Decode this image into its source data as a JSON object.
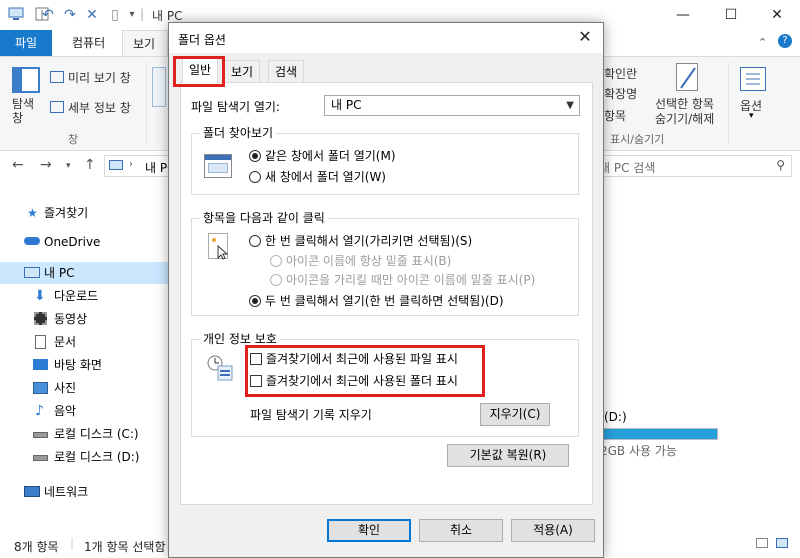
{
  "explorer": {
    "title": "내 PC",
    "tabs": {
      "file": "파일",
      "computer": "컴퓨터",
      "view": "보기"
    },
    "ribbon": {
      "navigation_pane": "탐색\n창",
      "preview_pane": "미리 보기 창",
      "details_pane": "세부 정보 창",
      "group_panes": "창",
      "item_checkboxes": "확인란",
      "file_extensions": "확장명",
      "hidden_items": "항목",
      "hide_selected": "선택한 항목",
      "hide_selected_2": "숨기기/해제",
      "group_show_hide": "표시/숨기기",
      "options": "옵션"
    },
    "address": {
      "path": "내 PC",
      "search_placeholder": "내 PC 검색"
    },
    "sidebar": [
      {
        "label": "즐겨찾기",
        "icon": "star-icon"
      },
      {
        "label": "OneDrive",
        "icon": "cloud-icon"
      },
      {
        "label": "내 PC",
        "icon": "pc-icon",
        "selected": true
      },
      {
        "label": "다운로드",
        "icon": "download-icon"
      },
      {
        "label": "동영상",
        "icon": "video-icon"
      },
      {
        "label": "문서",
        "icon": "document-icon"
      },
      {
        "label": "바탕 화면",
        "icon": "desktop-icon"
      },
      {
        "label": "사진",
        "icon": "picture-icon"
      },
      {
        "label": "음악",
        "icon": "music-icon"
      },
      {
        "label": "로컬 디스크 (C:)",
        "icon": "drive-icon"
      },
      {
        "label": "로컬 디스크 (D:)",
        "icon": "drive-icon"
      },
      {
        "label": "네트워크",
        "icon": "network-icon"
      }
    ],
    "drive": {
      "label": "(D:)",
      "free": "2GB 사용 가능",
      "fill_fraction": 1.0
    },
    "status": {
      "count": "8개 항목",
      "selected": "1개 항목 선택함"
    },
    "colors": {
      "accent": "#1979ca",
      "selection": "#cce8ff",
      "drive_bar": "#26a0da"
    }
  },
  "dialog": {
    "title": "폴더 옵션",
    "tabs": [
      "일반",
      "보기",
      "검색"
    ],
    "open_explorer_label": "파일 탐색기 열기:",
    "open_explorer_value": "내 PC",
    "browse_folders": {
      "title": "폴더 찾아보기",
      "same_window": "같은 창에서 폴더 열기(M)",
      "new_window": "새 창에서 폴더 열기(W)"
    },
    "click_items": {
      "title": "항목을 다음과 같이 클릭",
      "single_click": "한 번 클릭해서 열기(가리키면 선택됨)(S)",
      "underline_always": "아이콘 이름에 항상 밑줄 표시(B)",
      "underline_hover": "아이콘을 가리킬 때만 아이콘 이름에 밑줄 표시(P)",
      "double_click": "두 번 클릭해서 열기(한 번 클릭하면 선택됨)(D)"
    },
    "privacy": {
      "title": "개인 정보 보호",
      "recent_files": "즐겨찾기에서 최근에 사용된 파일 표시",
      "recent_folders": "즐겨찾기에서 최근에 사용된 폴더 표시",
      "clear_history": "파일 탐색기 기록 지우기",
      "clear_button": "지우기(C)"
    },
    "restore_defaults": "기본값 복원(R)",
    "ok": "확인",
    "cancel": "취소",
    "apply": "적용(A)",
    "highlight_color": "#e0211d"
  }
}
